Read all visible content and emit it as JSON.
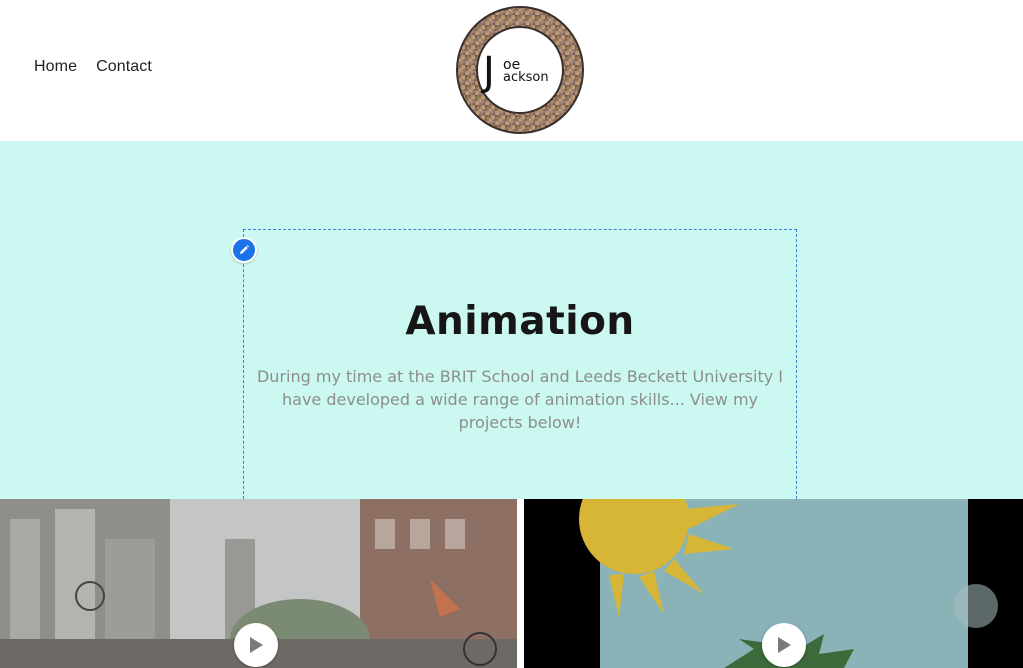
{
  "nav": {
    "items": [
      {
        "label": "Home"
      },
      {
        "label": "Contact"
      }
    ]
  },
  "logo": {
    "line1": "oe",
    "line2": "ackson",
    "initial": "J"
  },
  "hero": {
    "title": "Animation",
    "description": "During my time at the BRIT School and Leeds Beckett University I have developed a wide range of animation skills... View my projects below!"
  },
  "colors": {
    "hero_bg": "#cbf8f0",
    "edit_accent": "#1a73e8"
  },
  "icons": [
    "pencil-icon",
    "play-icon"
  ]
}
